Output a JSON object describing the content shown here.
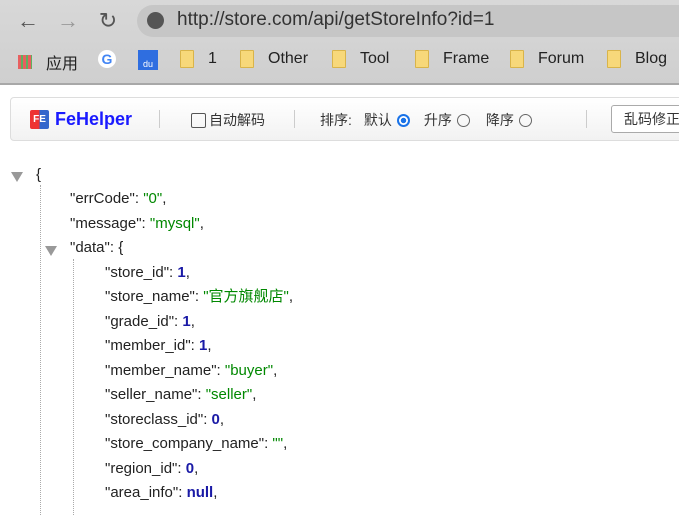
{
  "browser": {
    "url": "http://store.com/api/getStoreInfo?id=1",
    "bookmarks": [
      {
        "label": "应用",
        "icon": "apps-grid-icon"
      },
      {
        "label": "",
        "icon": "google-icon"
      },
      {
        "label": "",
        "icon": "baidu-icon"
      },
      {
        "label": "1",
        "icon": "folder-icon"
      },
      {
        "label": "Other",
        "icon": "folder-icon"
      },
      {
        "label": "Tool",
        "icon": "folder-icon"
      },
      {
        "label": "Frame",
        "icon": "folder-icon"
      },
      {
        "label": "Forum",
        "icon": "folder-icon"
      },
      {
        "label": "Blog",
        "icon": "folder-icon"
      }
    ]
  },
  "toolbar": {
    "brand": "FeHelper",
    "logo": "FE",
    "auto_decode": "自动解码",
    "sort_label": "排序:",
    "sort_default": "默认",
    "sort_asc": "升序",
    "sort_desc": "降序",
    "fix_button": "乱码修正"
  },
  "json": {
    "root": [
      {
        "key": "errCode",
        "value": "\"0\"",
        "type": "str"
      },
      {
        "key": "message",
        "value": "\"mysql\"",
        "type": "str"
      }
    ],
    "data_key": "data",
    "data": [
      {
        "key": "store_id",
        "value": "1",
        "type": "num"
      },
      {
        "key": "store_name",
        "value": "\"官方旗舰店\"",
        "type": "str"
      },
      {
        "key": "grade_id",
        "value": "1",
        "type": "num"
      },
      {
        "key": "member_id",
        "value": "1",
        "type": "num"
      },
      {
        "key": "member_name",
        "value": "\"buyer\"",
        "type": "str"
      },
      {
        "key": "seller_name",
        "value": "\"seller\"",
        "type": "str"
      },
      {
        "key": "storeclass_id",
        "value": "0",
        "type": "num"
      },
      {
        "key": "store_company_name",
        "value": "\"\"",
        "type": "str"
      },
      {
        "key": "region_id",
        "value": "0",
        "type": "num"
      },
      {
        "key": "area_info",
        "value": "null",
        "type": "num"
      }
    ]
  }
}
